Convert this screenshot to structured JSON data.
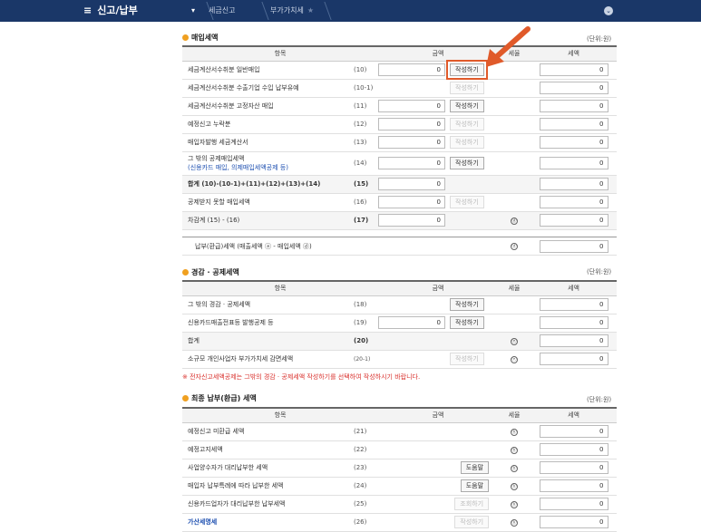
{
  "topbar": {
    "menu_label": "신고/납부",
    "crumbs": [
      "세금신고",
      "부가가치세"
    ]
  },
  "sections": {
    "purchase": {
      "title": "매입세액",
      "unit": "(단위:원)",
      "headers": {
        "item": "항목",
        "amount": "금액",
        "rate": "세율",
        "tax": "세액"
      },
      "rows": [
        {
          "label": "세금계산서수취분 일반매입",
          "no": "(10)",
          "amount": "0",
          "button": "작성하기",
          "tax": "0"
        },
        {
          "label": "세금계산서수취분 수출기업 수입 납부유예",
          "no": "(10-1)",
          "button": "작성하기",
          "tax": "0"
        },
        {
          "label": "세금계산서수취분 고정자산 매입",
          "no": "(11)",
          "amount": "0",
          "button": "작성하기",
          "tax": "0"
        },
        {
          "label": "예정신고 누락분",
          "no": "(12)",
          "amount": "0",
          "button": "작성하기",
          "tax": "0"
        },
        {
          "label": "매입자발행 세금계산서",
          "no": "(13)",
          "amount": "0",
          "button": "작성하기",
          "tax": "0"
        },
        {
          "label": "그 밖의 공제매입세액",
          "label2": "(신용카드 매입, 의제매입세액공제 등)",
          "no": "(14)",
          "amount": "0",
          "button": "작성하기",
          "tax": "0"
        },
        {
          "label": "합계 (10)-(10-1)+(11)+(12)+(13)+(14)",
          "no": "(15)",
          "amount": "0",
          "tax": "0"
        },
        {
          "label": "공제받지 못할 매입세액",
          "no": "(16)",
          "amount": "0",
          "button": "작성하기",
          "tax": "0"
        },
        {
          "label": "차감계 (15) - (16)",
          "no": "(17)",
          "amount": "0",
          "rate": "ⓓ",
          "tax": "0"
        }
      ],
      "payable": {
        "label": "납부(환급)세액 (매출세액 ⓐ - 매입세액 ⓓ)",
        "rate": "ⓓ",
        "tax": "0"
      }
    },
    "reduction": {
      "title": "경감 · 공제세액",
      "unit": "(단위:원)",
      "headers": {
        "item": "항목",
        "amount": "금액",
        "rate": "세율",
        "tax": "세액"
      },
      "rows": [
        {
          "label": "그 밖의 경감 · 공제세액",
          "no": "(18)",
          "button": "작성하기",
          "tax": "0"
        },
        {
          "label": "신용카드매출전표등 발행공제 등",
          "no": "(19)",
          "amount": "0",
          "button": "작성하기",
          "tax": "0"
        },
        {
          "label": "합계",
          "no": "(20)",
          "rate": "ⓔ",
          "tax": "0"
        },
        {
          "label": "소규모 개인사업자 부가가치세 감면세액",
          "no": "(20-1)",
          "button": "작성하기",
          "rate": "ⓔ",
          "tax": "0"
        }
      ],
      "notice": "※ 전자신고세액공제는 그밖의 경감 · 공제세액 작성하기를 선택하여 작성하시기 바랍니다."
    },
    "final": {
      "title": "최종 납부(환급) 세액",
      "unit": "(단위:원)",
      "headers": {
        "item": "항목",
        "amount": "금액",
        "rate": "세율",
        "tax": "세액"
      },
      "rows": [
        {
          "label": "예정신고 미환급 세액",
          "no": "(21)",
          "rate": "ⓑ",
          "tax": "0"
        },
        {
          "label": "예정고지세액",
          "no": "(22)",
          "rate": "ⓑ",
          "tax": "0"
        },
        {
          "label": "사업양수자가 대리납부한 세액",
          "no": "(23)",
          "button": "도움말",
          "rate": "ⓑ",
          "tax": "0"
        },
        {
          "label": "매입자 납부특례에 따라 납부한 세액",
          "no": "(24)",
          "button": "도움말",
          "rate": "ⓑ",
          "tax": "0"
        },
        {
          "label": "신용카드업자가 대리납부한 납부세액",
          "no": "(25)",
          "button": "조회하기",
          "rate": "ⓑ",
          "tax": "0"
        },
        {
          "label": "가산세명세",
          "no": "(26)",
          "button": "작성하기",
          "rate": "ⓑ",
          "tax": "0"
        }
      ]
    }
  }
}
